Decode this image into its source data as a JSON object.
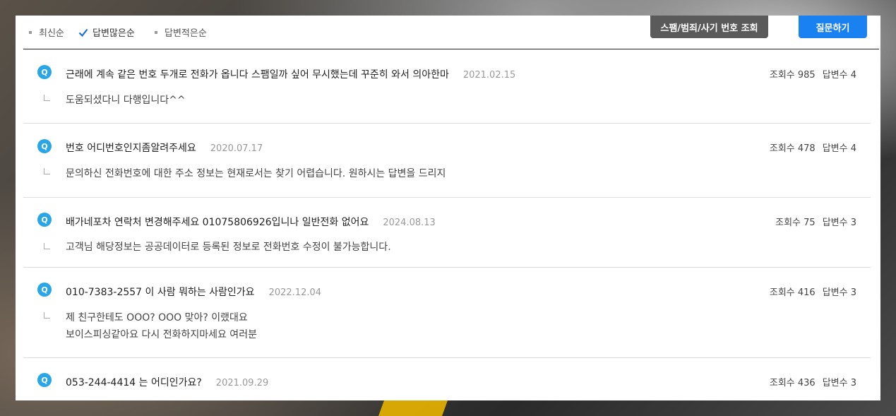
{
  "sort": {
    "options": [
      {
        "label": "최신순",
        "active": false
      },
      {
        "label": "답변많은순",
        "active": true
      },
      {
        "label": "답변적은순",
        "active": false
      }
    ]
  },
  "buttons": {
    "spam_lookup": "스팸/범죄/사기 번호 조회",
    "ask": "질문하기"
  },
  "icon_letter": "Q",
  "questions": [
    {
      "title": "근래에 계속 같은 번호 두개로 전화가 옵니다 스팸일까 싶어 무시했는데 꾸준히 와서 의아한마",
      "date": "2021.02.15",
      "views": "조회수 985",
      "answers": "답변수 4",
      "answer_lines": [
        "도움되셨다니 다행입니다^^"
      ]
    },
    {
      "title": "번호 어디번호인지좀알려주세요",
      "date": "2020.07.17",
      "views": "조회수 478",
      "answers": "답변수 4",
      "answer_lines": [
        "문의하신 전화번호에 대한 주소 정보는 현재로서는 찾기 어렵습니다. 원하시는 답변을 드리지"
      ]
    },
    {
      "title": "배가네포차 연락처 변경해주세요 01075806926입니나 일반전화 없어요",
      "date": "2024.08.13",
      "views": "조회수 75",
      "answers": "답변수 3",
      "answer_lines": [
        "고객님 해당정보는 공공데이터로 등록된 정보로 전화번호 수정이 불가능합니다."
      ]
    },
    {
      "title": "010-7383-2557 이 사람 뭐하는 사람인가요",
      "date": "2022.12.04",
      "views": "조회수 416",
      "answers": "답변수 3",
      "answer_lines": [
        "제 친구한테도 OOO? OOO 맞아? 이랬대요",
        "보이스피싱같아요 다시 전화하지마세요 여러분"
      ]
    },
    {
      "title": "053-244-4414 는 어디인가요?",
      "date": "2021.09.29",
      "views": "조회수 436",
      "answers": "답변수 3",
      "answer_lines": []
    }
  ],
  "colors": {
    "accent_blue": "#1a82f0",
    "icon_blue": "#29a6e6",
    "dark_button": "#5a5a5a"
  }
}
